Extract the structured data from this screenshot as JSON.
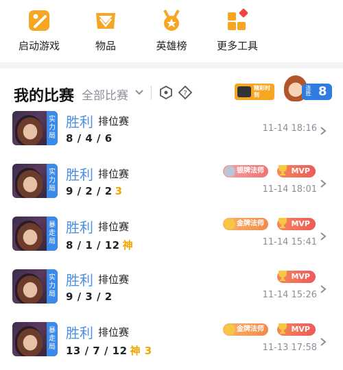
{
  "toolbar": {
    "items": [
      {
        "label": "启动游戏",
        "icon": "game-launch-icon"
      },
      {
        "label": "物品",
        "icon": "items-icon"
      },
      {
        "label": "英雄榜",
        "icon": "hero-rank-icon"
      },
      {
        "label": "更多工具",
        "icon": "more-tools-icon"
      }
    ]
  },
  "header": {
    "title": "我的比赛",
    "filter": "全部比赛",
    "highlight_banner": "精彩时刻",
    "streak_label": "连胜",
    "streak_count": "8"
  },
  "matches": [
    {
      "result": "胜利",
      "mode": "排位赛",
      "kda": "8 / 4 / 6",
      "extra": "",
      "time": "11-14 18:16",
      "tag": [
        "实",
        "力",
        "局"
      ],
      "badge": "",
      "mvp": ""
    },
    {
      "result": "胜利",
      "mode": "排位赛",
      "kda": "9 / 2 / 2",
      "extra": "3",
      "time": "11-14 18:01",
      "tag": [
        "实",
        "力",
        "局"
      ],
      "badge": "银牌法师",
      "mvp": "MVP"
    },
    {
      "result": "胜利",
      "mode": "排位赛",
      "kda": "8 / 1 / 12",
      "extra": "神",
      "time": "11-14 15:41",
      "tag": [
        "暴",
        "走",
        "局"
      ],
      "badge": "金牌法师",
      "mvp": "MVP"
    },
    {
      "result": "胜利",
      "mode": "排位赛",
      "kda": "9 / 3 / 2",
      "extra": "",
      "time": "11-14 15:26",
      "tag": [
        "实",
        "力",
        "局"
      ],
      "badge": "",
      "mvp": "MVP"
    },
    {
      "result": "胜利",
      "mode": "排位赛",
      "kda": "13 / 7 / 12",
      "extra": "神 3",
      "time": "11-13 17:58",
      "tag": [
        "暴",
        "走",
        "局"
      ],
      "badge": "金牌法师",
      "mvp": "MVP"
    }
  ],
  "colors": {
    "accent": "#f6a623",
    "win": "#4a8fe0",
    "tag": "#3b89e8",
    "gold": "#f0a500"
  }
}
